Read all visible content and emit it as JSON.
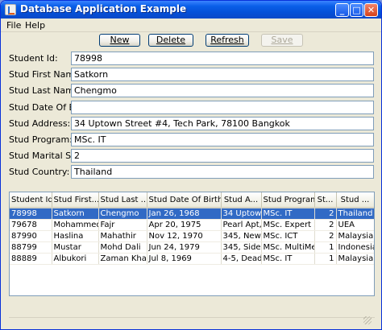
{
  "window": {
    "title": "Database Application Example"
  },
  "menu": [
    "File",
    "Help"
  ],
  "toolbar": {
    "new_label": "New",
    "delete_label": "Delete",
    "refresh_label": "Refresh",
    "save_label": "Save"
  },
  "form": [
    {
      "label": "Student Id:",
      "value": "78998"
    },
    {
      "label": "Stud First Name:",
      "value": "Satkorn"
    },
    {
      "label": "Stud Last Name:",
      "value": "Chengmo"
    },
    {
      "label": "Stud Date Of Birth:",
      "value": ""
    },
    {
      "label": "Stud Address:",
      "value": "34 Uptown Street #4, Tech Park, 78100 Bangkok"
    },
    {
      "label": "Stud Program:",
      "value": "MSc. IT"
    },
    {
      "label": "Stud Marital Status:",
      "value": "2"
    },
    {
      "label": "Stud Country:",
      "value": "Thailand"
    }
  ],
  "table": {
    "columns": [
      "Student Id",
      "Stud First...",
      "Stud Last ...",
      "Stud Date Of Birth",
      "Stud A...",
      "Stud Program",
      "St...",
      "Stud ..."
    ],
    "rows": [
      [
        "78998",
        "Satkorn",
        "Chengmo",
        "Jan 26, 1968",
        "34 Uptow...",
        "MSc. IT",
        "2",
        "Thailand"
      ],
      [
        "79678",
        "Mohammed",
        "Fajr",
        "Apr 20, 1975",
        "Pearl Apt,...",
        "MSc. Expert S...",
        "2",
        "UEA"
      ],
      [
        "87990",
        "Haslina",
        "Mahathir",
        "Nov 12, 1970",
        "345, New...",
        "MSc. ICT",
        "2",
        "Malaysia"
      ],
      [
        "88799",
        "Mustar",
        "Mohd Dali",
        "Jun 24, 1979",
        "345, Side ...",
        "MSc. MultiMedia",
        "1",
        "Indonesia"
      ],
      [
        "88889",
        "Albukori",
        "Zaman Khan",
        "Jul 8, 1969",
        "4-5, Dead...",
        "MSc. IT",
        "1",
        "Malaysia"
      ]
    ],
    "selected_row": 0
  },
  "colors": {
    "titlebar": "#0a5fe8",
    "selection": "#316ac5",
    "window_bg": "#ece9d8"
  }
}
